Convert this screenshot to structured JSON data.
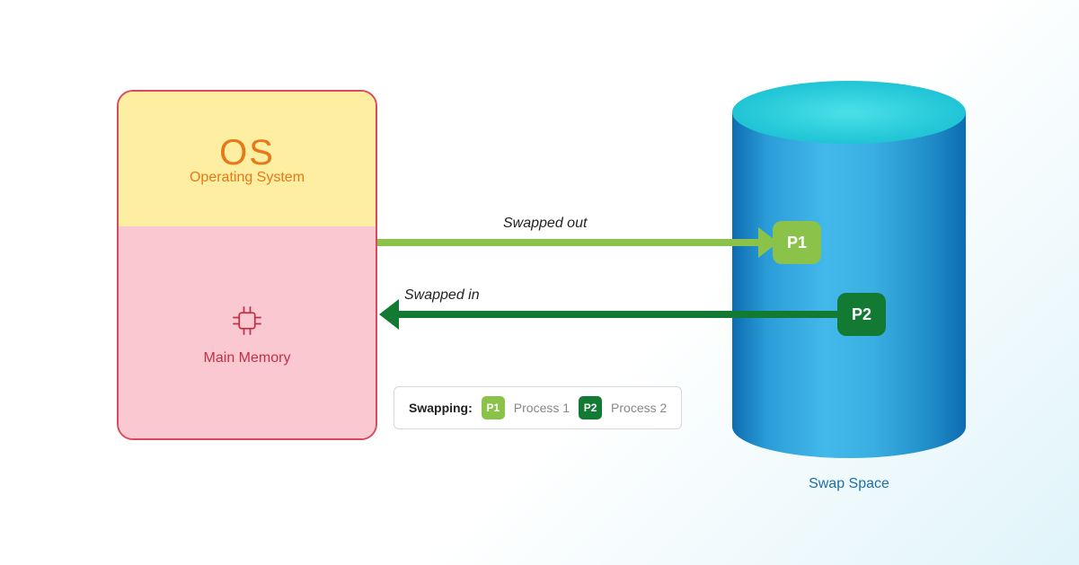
{
  "memory": {
    "os": {
      "title": "OS",
      "subtitle": "Operating System"
    },
    "main": {
      "label": "Main Memory"
    }
  },
  "swap": {
    "label": "Swap Space",
    "p1": "P1",
    "p2": "P2"
  },
  "arrows": {
    "out_label": "Swapped out",
    "in_label": "Swapped in"
  },
  "legend": {
    "title": "Swapping:",
    "p1_badge": "P1",
    "p1_text": "Process 1",
    "p2_badge": "P2",
    "p2_text": "Process 2"
  },
  "colors": {
    "p1": "#8bc34a",
    "p2": "#127a33",
    "os_bg": "#fdeea1",
    "mm_bg": "#f9c8d0",
    "os_text": "#e67817",
    "mm_text": "#c23048",
    "border": "#d94a5a"
  }
}
